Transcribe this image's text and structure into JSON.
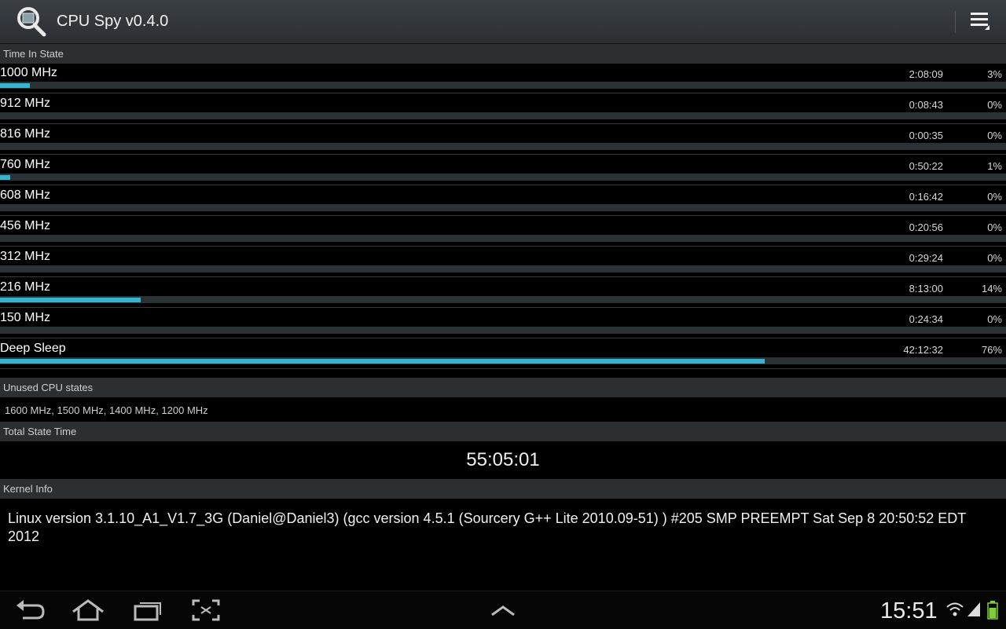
{
  "app": {
    "title": "CPU Spy v0.4.0"
  },
  "sections": {
    "time_in_state": "Time In State",
    "unused_cpu_states": "Unused CPU states",
    "total_state_time": "Total State Time",
    "kernel_info": "Kernel Info"
  },
  "states": [
    {
      "name": "1000 MHz",
      "time": "2:08:09",
      "percent": "3%",
      "bar_fraction": 0.03
    },
    {
      "name": "912 MHz",
      "time": "0:08:43",
      "percent": "0%",
      "bar_fraction": 0.0
    },
    {
      "name": "816 MHz",
      "time": "0:00:35",
      "percent": "0%",
      "bar_fraction": 0.0
    },
    {
      "name": "760 MHz",
      "time": "0:50:22",
      "percent": "1%",
      "bar_fraction": 0.01
    },
    {
      "name": "608 MHz",
      "time": "0:16:42",
      "percent": "0%",
      "bar_fraction": 0.0
    },
    {
      "name": "456 MHz",
      "time": "0:20:56",
      "percent": "0%",
      "bar_fraction": 0.0
    },
    {
      "name": "312 MHz",
      "time": "0:29:24",
      "percent": "0%",
      "bar_fraction": 0.0
    },
    {
      "name": "216 MHz",
      "time": "8:13:00",
      "percent": "14%",
      "bar_fraction": 0.14
    },
    {
      "name": "150 MHz",
      "time": "0:24:34",
      "percent": "0%",
      "bar_fraction": 0.0
    },
    {
      "name": "Deep Sleep",
      "time": "42:12:32",
      "percent": "76%",
      "bar_fraction": 0.76
    }
  ],
  "unused_states": "1600 MHz, 1500 MHz, 1400 MHz, 1200 MHz",
  "total_time": "55:05:01",
  "kernel": "Linux version 3.1.10_A1_V1.7_3G (Daniel@Daniel3) (gcc version 4.5.1 (Sourcery G++ Lite 2010.09-51) ) #205 SMP PREEMPT Sat Sep 8 20:50:52 EDT 2012",
  "status_bar": {
    "clock": "15:51"
  },
  "icons": {
    "app": "magnifier-chip-icon",
    "overflow": "overflow-menu-icon",
    "back": "back-icon",
    "home": "home-icon",
    "recents": "recent-apps-icon",
    "screenshot": "screenshot-icon",
    "up": "chevron-up-icon",
    "wifi": "wifi-icon",
    "signal": "signal-icon",
    "battery": "battery-icon"
  },
  "colors": {
    "accent": "#35b4d2",
    "track": "#2b3236",
    "header_bg": "#2c2f31"
  }
}
